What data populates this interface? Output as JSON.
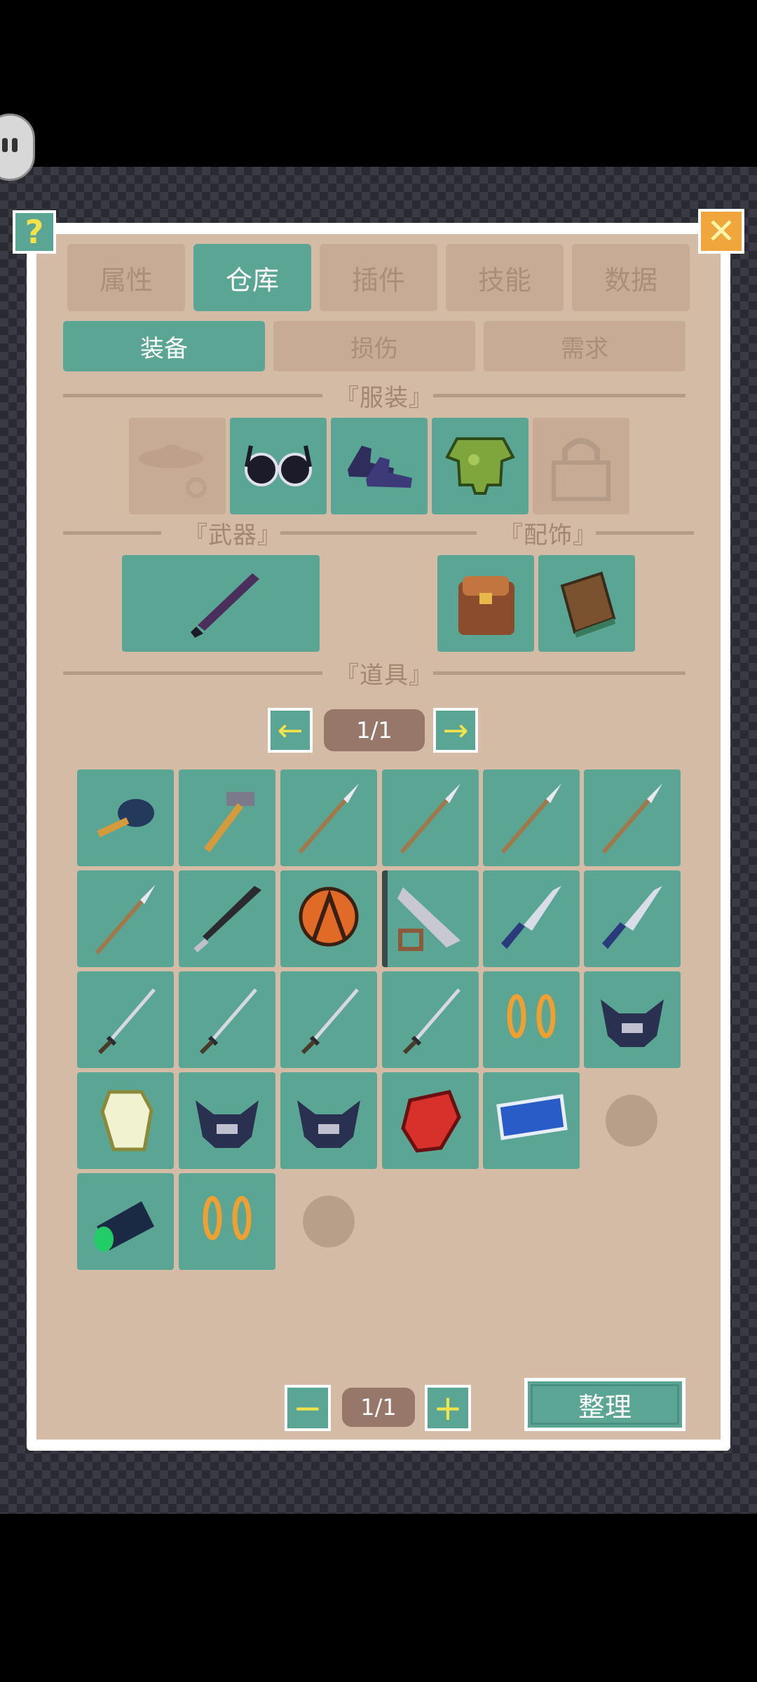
{
  "help_label": "?",
  "close_label": "✕",
  "tabs": [
    "属性",
    "仓库",
    "插件",
    "技能",
    "数据"
  ],
  "active_tab": "仓库",
  "subtabs": [
    "装备",
    "损伤",
    "需求"
  ],
  "active_subtab": "装备",
  "sections": {
    "clothing": "『服装』",
    "weapon": "『武器』",
    "accessory": "『配饰』",
    "items": "『道具』"
  },
  "clothing_slots": [
    "hat-icon",
    "glasses-icon",
    "shoes-icon",
    "armor-icon",
    "lock-icon"
  ],
  "weapon_slot": "sword-icon",
  "accessory_slots": [
    "backpack-icon",
    "book-icon"
  ],
  "items_pager": {
    "prev": "←",
    "page": "1/1",
    "next": "→"
  },
  "inventory": [
    [
      "pan-icon",
      "hammer-icon",
      "spear-icon",
      "spear-icon",
      "spear-icon",
      "spear-icon"
    ],
    [
      "spear-icon",
      "blade-icon",
      "shield-icon",
      "saw-icon",
      "dagger-icon",
      "dagger-icon"
    ],
    [
      "sword-icon",
      "sword-icon",
      "sword-icon",
      "sword-icon",
      "chain-icon",
      "mask-icon"
    ],
    [
      "gem-icon",
      "mask-icon",
      "mask-icon",
      "glove-icon",
      "card-icon",
      "empty"
    ],
    [
      "scope-icon",
      "chain-icon",
      "empty"
    ]
  ],
  "footer": {
    "minus": "−",
    "page": "1/1",
    "plus": "+",
    "sort_label": "整理"
  },
  "colors": {
    "teal": "#5ba594",
    "tan": "#d3bba6",
    "dim_tan": "#c8ab94",
    "yellow": "#f4e24a"
  }
}
